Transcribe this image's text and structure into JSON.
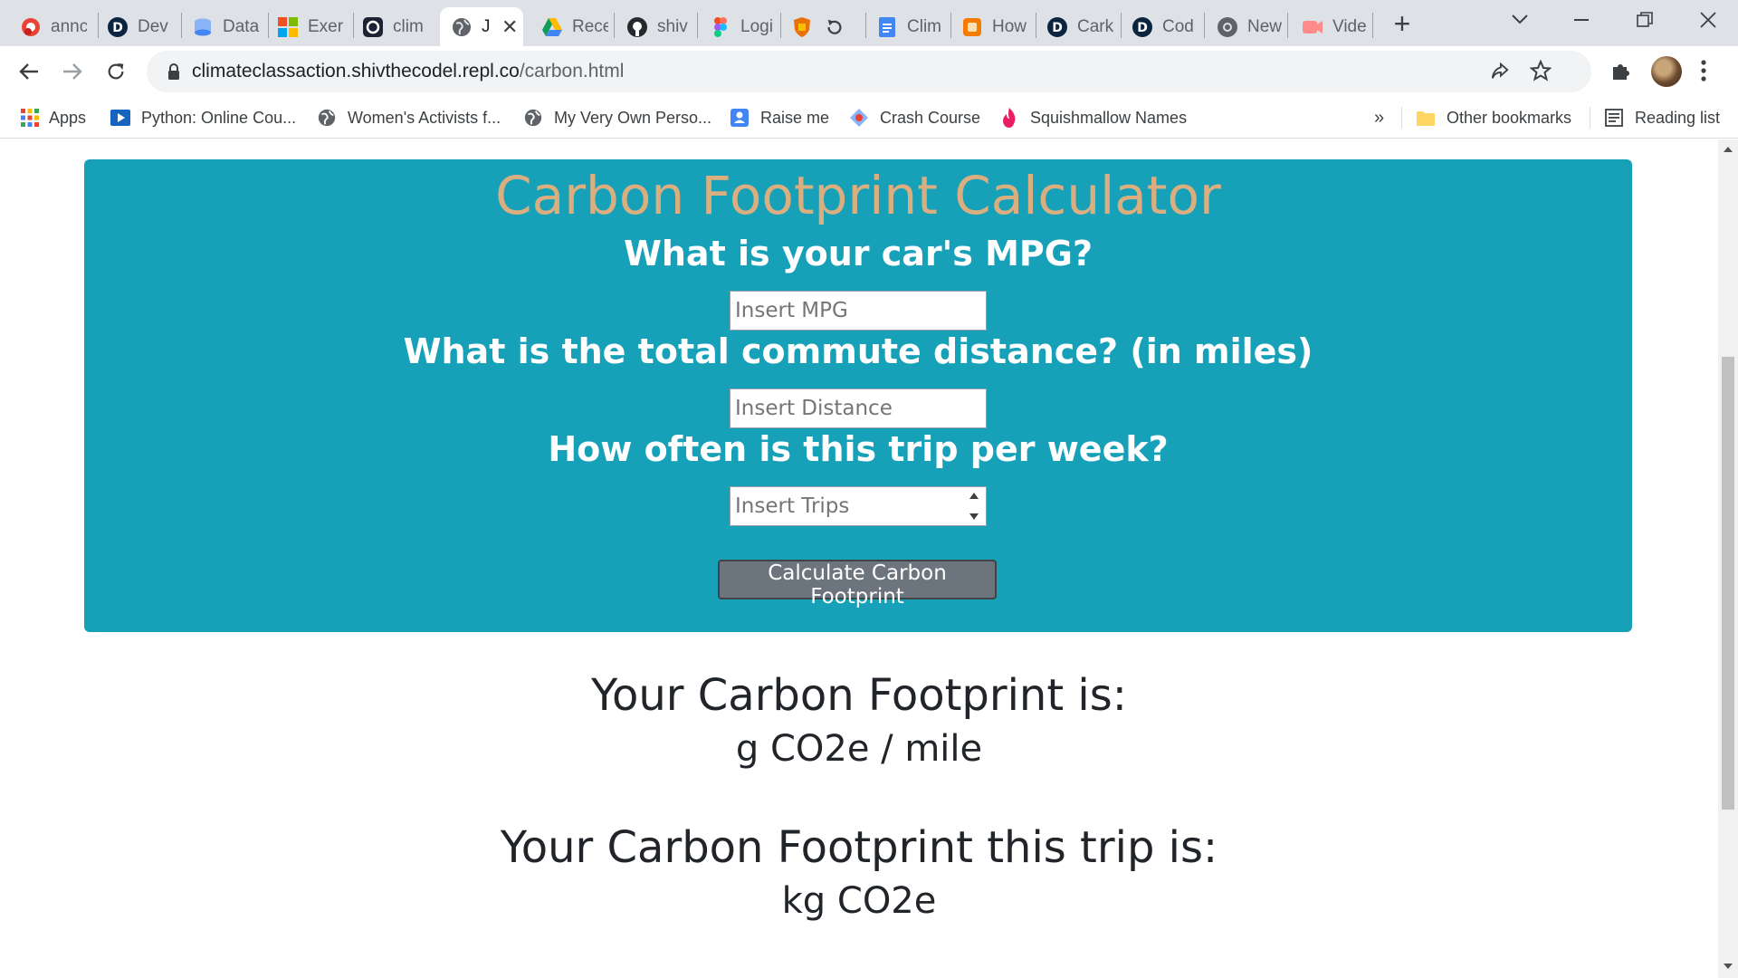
{
  "browser": {
    "tabs": [
      {
        "title": "annc",
        "icon": "gmail-icon"
      },
      {
        "title": "Dev",
        "icon": "d-app-icon"
      },
      {
        "title": "Data",
        "icon": "database-icon"
      },
      {
        "title": "Exer",
        "icon": "microsoft-icon"
      },
      {
        "title": "clim",
        "icon": "replit-icon"
      },
      {
        "title": "J",
        "icon": "globe-icon",
        "active": true
      },
      {
        "title": "Rece",
        "icon": "google-drive-icon"
      },
      {
        "title": "shiv",
        "icon": "github-icon"
      },
      {
        "title": "Logi",
        "icon": "figma-icon"
      },
      {
        "title": "",
        "icon": "shield-icon"
      },
      {
        "title": "Clim",
        "icon": "google-docs-icon"
      },
      {
        "title": "How",
        "icon": "orange-app-icon"
      },
      {
        "title": "Cark",
        "icon": "d-app-icon"
      },
      {
        "title": "Cod",
        "icon": "d-app-icon"
      },
      {
        "title": "New",
        "icon": "chrome-icon"
      },
      {
        "title": "Vide",
        "icon": "video-icon"
      }
    ],
    "url_host": "climateclassaction.shivthecodel.repl.co",
    "url_path": "/carbon.html"
  },
  "bookmarks": {
    "apps": "Apps",
    "items": [
      "Python: Online Cou...",
      "Women's Activists f...",
      "My Very Own Perso...",
      "Raise me",
      "Crash Course",
      "Squishmallow Names"
    ],
    "overflow": "»",
    "other": "Other bookmarks",
    "reading": "Reading list"
  },
  "page": {
    "title": "Carbon Footprint Calculator",
    "q_mpg": "What is your car's MPG?",
    "mpg_placeholder": "Insert MPG",
    "q_distance": "What is the total commute distance? (in miles)",
    "distance_placeholder": "Insert Distance",
    "q_trips": "How often is this trip per week?",
    "trips_placeholder": "Insert Trips",
    "button": "Calculate Carbon Footprint",
    "result1_heading": "Your Carbon Footprint is:",
    "result1_value": "g CO2e / mile",
    "result2_heading": "Your Carbon Footprint this trip is:",
    "result2_value": "kg CO2e"
  },
  "colors": {
    "panel": "#17a1b8",
    "title": "#dbae7f",
    "button": "#6c757d"
  }
}
